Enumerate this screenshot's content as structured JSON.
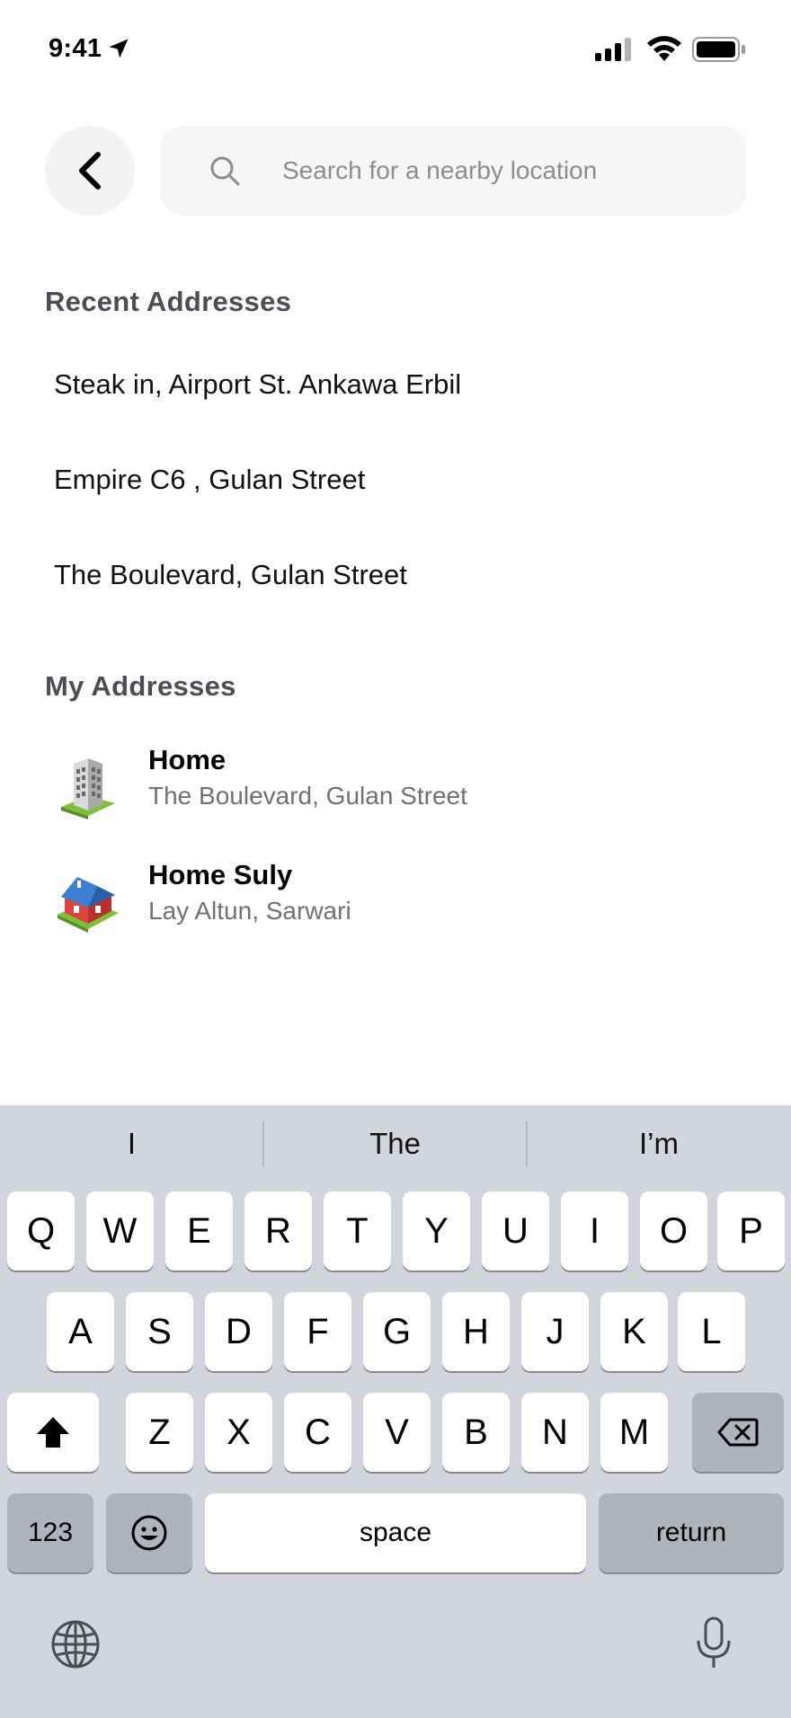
{
  "status_bar": {
    "time": "9:41"
  },
  "search": {
    "placeholder": "Search for a nearby location",
    "value": ""
  },
  "recent": {
    "title": "Recent Addresses",
    "items": [
      "Steak in, Airport St. Ankawa Erbil",
      "Empire C6 , Gulan Street",
      "The Boulevard, Gulan Street"
    ]
  },
  "my_addresses": {
    "title": "My Addresses",
    "items": [
      {
        "name": "Home",
        "address": "The Boulevard, Gulan Street",
        "icon": "office-building-icon"
      },
      {
        "name": "Home Suly",
        "address": "Lay Altun, Sarwari",
        "icon": "house-icon"
      }
    ]
  },
  "keyboard": {
    "suggestions": [
      "I",
      "The",
      "I’m"
    ],
    "row1": [
      "Q",
      "W",
      "E",
      "R",
      "T",
      "Y",
      "U",
      "I",
      "O",
      "P"
    ],
    "row2": [
      "A",
      "S",
      "D",
      "F",
      "G",
      "H",
      "J",
      "K",
      "L"
    ],
    "row3": [
      "Z",
      "X",
      "C",
      "V",
      "B",
      "N",
      "M"
    ],
    "numbers_label": "123",
    "space_label": "space",
    "return_label": "return"
  },
  "colors": {
    "keyboard_bg": "#d2d5db",
    "section_title": "#4a4f57",
    "subtext": "#6e7277"
  }
}
